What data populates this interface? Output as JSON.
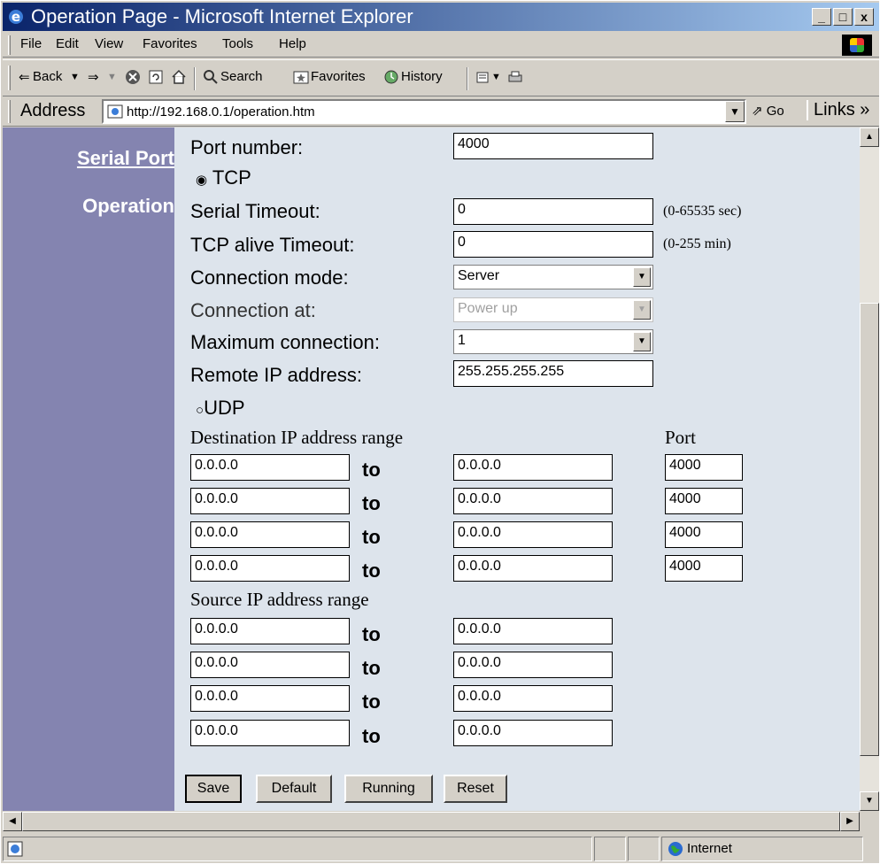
{
  "window": {
    "title": "Operation Page - Microsoft Internet Explorer",
    "minimize": "_",
    "maximize": "□",
    "close": "x"
  },
  "menu": [
    "File",
    "Edit",
    "View",
    "Favorites",
    "Tools",
    "Help"
  ],
  "toolbar": {
    "back": "Back",
    "search": "Search",
    "favorites": "Favorites",
    "history": "History"
  },
  "address": {
    "label": "Address",
    "url": "http://192.168.0.1/operation.htm",
    "go": "Go",
    "links": "Links »"
  },
  "sidebar": {
    "serial_port": "Serial Port",
    "operation": "Operation"
  },
  "form": {
    "port_number_label": "Port number:",
    "port_number": "4000",
    "tcp_label": "TCP",
    "serial_timeout_label": "Serial Timeout:",
    "serial_timeout": "0",
    "serial_timeout_hint": "(0-65535 sec)",
    "tcp_alive_label": "TCP alive Timeout:",
    "tcp_alive": "0",
    "tcp_alive_hint": "(0-255 min)",
    "connection_mode_label": "Connection mode:",
    "connection_mode": "Server",
    "connection_at_label": "Connection at:",
    "connection_at": "Power up",
    "max_connection_label": "Maximum connection:",
    "max_connection": "1",
    "remote_ip_label": "Remote IP address:",
    "remote_ip": "255.255.255.255",
    "udp_label": "UDP",
    "dest_range_label": "Destination IP address range",
    "port_label": "Port",
    "to_label": "to",
    "dest": [
      {
        "from": "0.0.0.0",
        "to": "0.0.0.0",
        "port": "4000"
      },
      {
        "from": "0.0.0.0",
        "to": "0.0.0.0",
        "port": "4000"
      },
      {
        "from": "0.0.0.0",
        "to": "0.0.0.0",
        "port": "4000"
      },
      {
        "from": "0.0.0.0",
        "to": "0.0.0.0",
        "port": "4000"
      }
    ],
    "source_range_label": "Source IP address range",
    "source": [
      {
        "from": "0.0.0.0",
        "to": "0.0.0.0"
      },
      {
        "from": "0.0.0.0",
        "to": "0.0.0.0"
      },
      {
        "from": "0.0.0.0",
        "to": "0.0.0.0"
      },
      {
        "from": "0.0.0.0",
        "to": "0.0.0.0"
      }
    ]
  },
  "buttons": {
    "save": "Save",
    "default": "Default",
    "running": "Running",
    "reset": "Reset"
  },
  "status": {
    "zone": "Internet"
  },
  "colors": {
    "sidebar": "#8484b0",
    "content_bg": "#dde4ec",
    "title_bar": "#0a246a"
  }
}
